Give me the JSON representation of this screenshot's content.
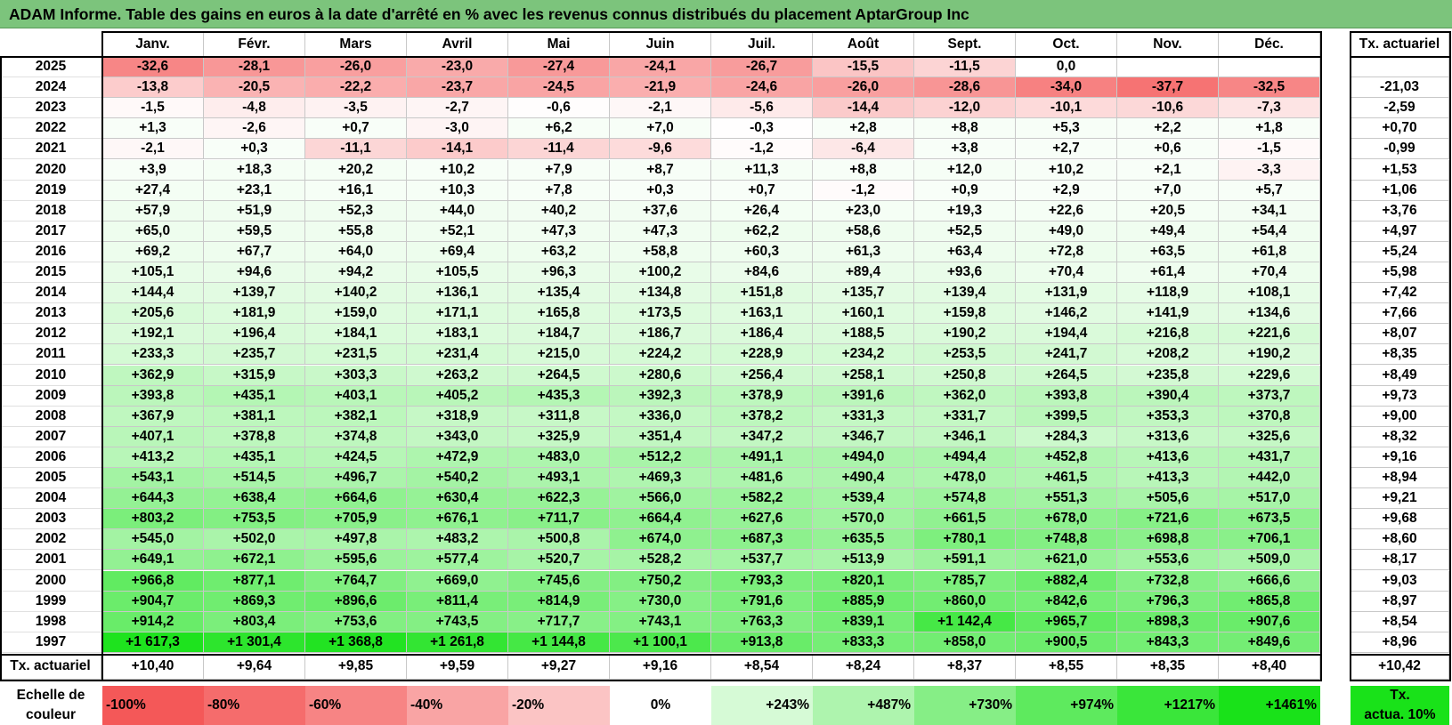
{
  "title": "ADAM Informe. Table des gains en euros à la date d'arrêté en % avec les revenus connus distribués du placement AptarGroup Inc",
  "chart_data": {
    "type": "heatmap",
    "title": "ADAM Informe. Table des gains en euros à la date d'arrêté en % avec les revenus connus distribués du placement AptarGroup Inc",
    "columns": [
      "Janv.",
      "Févr.",
      "Mars",
      "Avril",
      "Mai",
      "Juin",
      "Juil.",
      "Août",
      "Sept.",
      "Oct.",
      "Nov.",
      "Déc."
    ],
    "annual_header": "Tx. actuariel",
    "rows": [
      {
        "year": "2025",
        "values": [
          "-32,6",
          "-28,1",
          "-26,0",
          "-23,0",
          "-27,4",
          "-24,1",
          "-26,7",
          "-15,5",
          "-11,5",
          "0,0",
          "",
          ""
        ],
        "annual": ""
      },
      {
        "year": "2024",
        "values": [
          "-13,8",
          "-20,5",
          "-22,2",
          "-23,7",
          "-24,5",
          "-21,9",
          "-24,6",
          "-26,0",
          "-28,6",
          "-34,0",
          "-37,7",
          "-32,5"
        ],
        "annual": "-21,03"
      },
      {
        "year": "2023",
        "values": [
          "-1,5",
          "-4,8",
          "-3,5",
          "-2,7",
          "-0,6",
          "-2,1",
          "-5,6",
          "-14,4",
          "-12,0",
          "-10,1",
          "-10,6",
          "-7,3"
        ],
        "annual": "-2,59"
      },
      {
        "year": "2022",
        "values": [
          "+1,3",
          "-2,6",
          "+0,7",
          "-3,0",
          "+6,2",
          "+7,0",
          "-0,3",
          "+2,8",
          "+8,8",
          "+5,3",
          "+2,2",
          "+1,8"
        ],
        "annual": "+0,70"
      },
      {
        "year": "2021",
        "values": [
          "-2,1",
          "+0,3",
          "-11,1",
          "-14,1",
          "-11,4",
          "-9,6",
          "-1,2",
          "-6,4",
          "+3,8",
          "+2,7",
          "+0,6",
          "-1,5"
        ],
        "annual": "-0,99"
      },
      {
        "year": "2020",
        "values": [
          "+3,9",
          "+18,3",
          "+20,2",
          "+10,2",
          "+7,9",
          "+8,7",
          "+11,3",
          "+8,8",
          "+12,0",
          "+10,2",
          "+2,1",
          "-3,3"
        ],
        "annual": "+1,53"
      },
      {
        "year": "2019",
        "values": [
          "+27,4",
          "+23,1",
          "+16,1",
          "+10,3",
          "+7,8",
          "+0,3",
          "+0,7",
          "-1,2",
          "+0,9",
          "+2,9",
          "+7,0",
          "+5,7"
        ],
        "annual": "+1,06"
      },
      {
        "year": "2018",
        "values": [
          "+57,9",
          "+51,9",
          "+52,3",
          "+44,0",
          "+40,2",
          "+37,6",
          "+26,4",
          "+23,0",
          "+19,3",
          "+22,6",
          "+20,5",
          "+34,1"
        ],
        "annual": "+3,76"
      },
      {
        "year": "2017",
        "values": [
          "+65,0",
          "+59,5",
          "+55,8",
          "+52,1",
          "+47,3",
          "+47,3",
          "+62,2",
          "+58,6",
          "+52,5",
          "+49,0",
          "+49,4",
          "+54,4"
        ],
        "annual": "+4,97"
      },
      {
        "year": "2016",
        "values": [
          "+69,2",
          "+67,7",
          "+64,0",
          "+69,4",
          "+63,2",
          "+58,8",
          "+60,3",
          "+61,3",
          "+63,4",
          "+72,8",
          "+63,5",
          "+61,8"
        ],
        "annual": "+5,24"
      },
      {
        "year": "2015",
        "values": [
          "+105,1",
          "+94,6",
          "+94,2",
          "+105,5",
          "+96,3",
          "+100,2",
          "+84,6",
          "+89,4",
          "+93,6",
          "+70,4",
          "+61,4",
          "+70,4"
        ],
        "annual": "+5,98"
      },
      {
        "year": "2014",
        "values": [
          "+144,4",
          "+139,7",
          "+140,2",
          "+136,1",
          "+135,4",
          "+134,8",
          "+151,8",
          "+135,7",
          "+139,4",
          "+131,9",
          "+118,9",
          "+108,1"
        ],
        "annual": "+7,42"
      },
      {
        "year": "2013",
        "values": [
          "+205,6",
          "+181,9",
          "+159,0",
          "+171,1",
          "+165,8",
          "+173,5",
          "+163,1",
          "+160,1",
          "+159,8",
          "+146,2",
          "+141,9",
          "+134,6"
        ],
        "annual": "+7,66"
      },
      {
        "year": "2012",
        "values": [
          "+192,1",
          "+196,4",
          "+184,1",
          "+183,1",
          "+184,7",
          "+186,7",
          "+186,4",
          "+188,5",
          "+190,2",
          "+194,4",
          "+216,8",
          "+221,6"
        ],
        "annual": "+8,07"
      },
      {
        "year": "2011",
        "values": [
          "+233,3",
          "+235,7",
          "+231,5",
          "+231,4",
          "+215,0",
          "+224,2",
          "+228,9",
          "+234,2",
          "+253,5",
          "+241,7",
          "+208,2",
          "+190,2"
        ],
        "annual": "+8,35"
      },
      {
        "year": "2010",
        "values": [
          "+362,9",
          "+315,9",
          "+303,3",
          "+263,2",
          "+264,5",
          "+280,6",
          "+256,4",
          "+258,1",
          "+250,8",
          "+264,5",
          "+235,8",
          "+229,6"
        ],
        "annual": "+8,49"
      },
      {
        "year": "2009",
        "values": [
          "+393,8",
          "+435,1",
          "+403,1",
          "+405,2",
          "+435,3",
          "+392,3",
          "+378,9",
          "+391,6",
          "+362,0",
          "+393,8",
          "+390,4",
          "+373,7"
        ],
        "annual": "+9,73"
      },
      {
        "year": "2008",
        "values": [
          "+367,9",
          "+381,1",
          "+382,1",
          "+318,9",
          "+311,8",
          "+336,0",
          "+378,2",
          "+331,3",
          "+331,7",
          "+399,5",
          "+353,3",
          "+370,8"
        ],
        "annual": "+9,00"
      },
      {
        "year": "2007",
        "values": [
          "+407,1",
          "+378,8",
          "+374,8",
          "+343,0",
          "+325,9",
          "+351,4",
          "+347,2",
          "+346,7",
          "+346,1",
          "+284,3",
          "+313,6",
          "+325,6"
        ],
        "annual": "+8,32"
      },
      {
        "year": "2006",
        "values": [
          "+413,2",
          "+435,1",
          "+424,5",
          "+472,9",
          "+483,0",
          "+512,2",
          "+491,1",
          "+494,0",
          "+494,4",
          "+452,8",
          "+413,6",
          "+431,7"
        ],
        "annual": "+9,16"
      },
      {
        "year": "2005",
        "values": [
          "+543,1",
          "+514,5",
          "+496,7",
          "+540,2",
          "+493,1",
          "+469,3",
          "+481,6",
          "+490,4",
          "+478,0",
          "+461,5",
          "+413,3",
          "+442,0"
        ],
        "annual": "+8,94"
      },
      {
        "year": "2004",
        "values": [
          "+644,3",
          "+638,4",
          "+664,6",
          "+630,4",
          "+622,3",
          "+566,0",
          "+582,2",
          "+539,4",
          "+574,8",
          "+551,3",
          "+505,6",
          "+517,0"
        ],
        "annual": "+9,21"
      },
      {
        "year": "2003",
        "values": [
          "+803,2",
          "+753,5",
          "+705,9",
          "+676,1",
          "+711,7",
          "+664,4",
          "+627,6",
          "+570,0",
          "+661,5",
          "+678,0",
          "+721,6",
          "+673,5"
        ],
        "annual": "+9,68"
      },
      {
        "year": "2002",
        "values": [
          "+545,0",
          "+502,0",
          "+497,8",
          "+483,2",
          "+500,8",
          "+674,0",
          "+687,3",
          "+635,5",
          "+780,1",
          "+748,8",
          "+698,8",
          "+706,1"
        ],
        "annual": "+8,60"
      },
      {
        "year": "2001",
        "values": [
          "+649,1",
          "+672,1",
          "+595,6",
          "+577,4",
          "+520,7",
          "+528,2",
          "+537,7",
          "+513,9",
          "+591,1",
          "+621,0",
          "+553,6",
          "+509,0"
        ],
        "annual": "+8,17"
      },
      {
        "year": "2000",
        "values": [
          "+966,8",
          "+877,1",
          "+764,7",
          "+669,0",
          "+745,6",
          "+750,2",
          "+793,3",
          "+820,1",
          "+785,7",
          "+882,4",
          "+732,8",
          "+666,6"
        ],
        "annual": "+9,03"
      },
      {
        "year": "1999",
        "values": [
          "+904,7",
          "+869,3",
          "+896,6",
          "+811,4",
          "+814,9",
          "+730,0",
          "+791,6",
          "+885,9",
          "+860,0",
          "+842,6",
          "+796,3",
          "+865,8"
        ],
        "annual": "+8,97"
      },
      {
        "year": "1998",
        "values": [
          "+914,2",
          "+803,4",
          "+753,6",
          "+743,5",
          "+717,7",
          "+743,1",
          "+763,3",
          "+839,1",
          "+1 142,4",
          "+965,7",
          "+898,3",
          "+907,6"
        ],
        "annual": "+8,54"
      },
      {
        "year": "1997",
        "values": [
          "+1 617,3",
          "+1 301,4",
          "+1 368,8",
          "+1 261,8",
          "+1 144,8",
          "+1 100,1",
          "+913,8",
          "+833,3",
          "+858,0",
          "+900,5",
          "+843,3",
          "+849,6"
        ],
        "annual": "+8,96"
      }
    ],
    "footer": {
      "label": "Tx. actuariel",
      "values": [
        "+10,40",
        "+9,64",
        "+9,85",
        "+9,59",
        "+9,27",
        "+9,16",
        "+8,54",
        "+8,24",
        "+8,37",
        "+8,55",
        "+8,35",
        "+8,40"
      ],
      "annual": "+10,42"
    }
  },
  "scale": {
    "label_line1": "Echelle de",
    "label_line2": "couleur",
    "items": [
      {
        "text": "-100%",
        "color": "#f45858",
        "align": "left"
      },
      {
        "text": "-80%",
        "color": "#f56c6c",
        "align": "left"
      },
      {
        "text": "-60%",
        "color": "#f78484",
        "align": "left"
      },
      {
        "text": "-40%",
        "color": "#f9a4a4",
        "align": "left"
      },
      {
        "text": "-20%",
        "color": "#fbc4c4",
        "align": "left"
      },
      {
        "text": "0%",
        "color": "#ffffff",
        "align": "center"
      },
      {
        "text": "+243%",
        "color": "#d6fad6",
        "align": "right"
      },
      {
        "text": "+487%",
        "color": "#aef4ae",
        "align": "right"
      },
      {
        "text": "+730%",
        "color": "#86ee86",
        "align": "right"
      },
      {
        "text": "+974%",
        "color": "#5eea5e",
        "align": "right"
      },
      {
        "text": "+1217%",
        "color": "#3ae63a",
        "align": "right"
      },
      {
        "text": "+1461%",
        "color": "#19e219",
        "align": "right"
      }
    ],
    "key_line1": "Tx.",
    "key_line2": "actua. 10%",
    "key_color": "#19e219"
  },
  "colors": {
    "title_bg": "#7cc47c",
    "negative_max": "#f45858",
    "positive_max": "#19e219"
  }
}
